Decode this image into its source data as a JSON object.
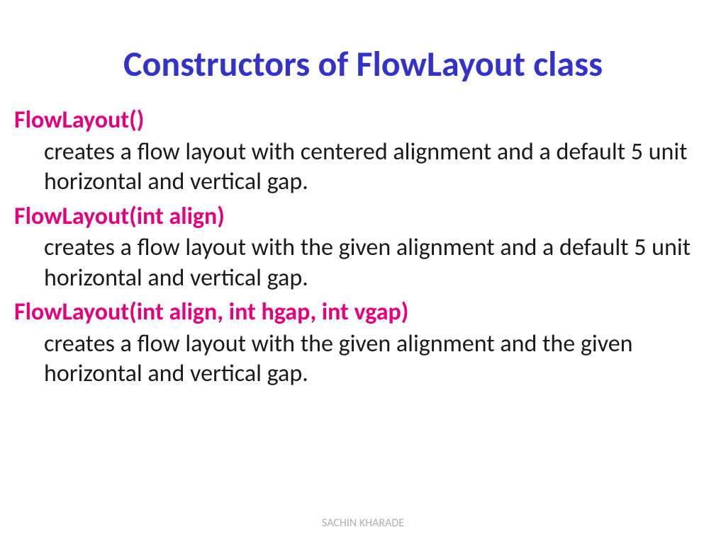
{
  "title": "Constructors of FlowLayout class",
  "constructors": [
    {
      "signature": "FlowLayout()",
      "description": " creates a flow layout with centered alignment and a default 5 unit horizontal and vertical gap."
    },
    {
      "signature": "FlowLayout(int align)",
      "description": "creates a flow layout with the given alignment and a default 5 unit horizontal and vertical gap."
    },
    {
      "signature": "FlowLayout(int align, int hgap, int vgap)",
      "description": "creates a flow layout with the given alignment and the given horizontal and vertical gap."
    }
  ],
  "footer": "SACHIN KHARADE"
}
